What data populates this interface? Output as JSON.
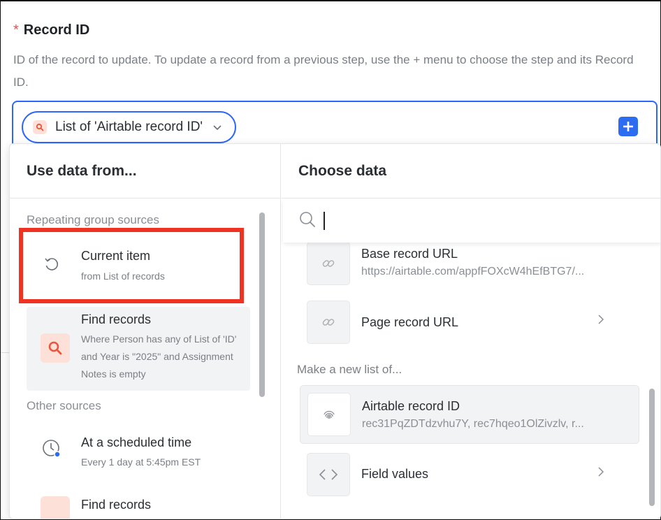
{
  "field": {
    "required_marker": "*",
    "label": "Record ID",
    "help": "ID of the record to update. To update a record from a previous step, use the + menu to choose the step and its Record ID."
  },
  "chip": {
    "label": "List of 'Airtable record ID'",
    "icon": "search-icon"
  },
  "plus_button": {
    "icon": "plus-icon"
  },
  "left_panel": {
    "header": "Use data from...",
    "sections": [
      {
        "title": "Repeating group sources",
        "items": [
          {
            "title": "Current item",
            "subtitle": "from List of records",
            "icon": "loop-icon"
          },
          {
            "title": "Find records",
            "subtitle": "Where Person has any of List of 'ID' and Year is \"2025\" and Assignment Notes is empty",
            "icon": "search-icon"
          }
        ]
      },
      {
        "title": "Other sources",
        "items": [
          {
            "title": "At a scheduled time",
            "subtitle": "Every 1 day at 5:45pm EST",
            "icon": "clock-icon"
          },
          {
            "title": "Find records",
            "subtitle": "",
            "icon": "search-icon"
          }
        ]
      }
    ]
  },
  "right_panel": {
    "header": "Choose data",
    "search": {
      "value": "",
      "icon": "search-icon"
    },
    "items": [
      {
        "title": "Base record URL",
        "subtitle": "https://airtable.com/appfFOXcW4hEfBTG7/...",
        "icon": "link-icon"
      },
      {
        "title": "Page record URL",
        "subtitle": "",
        "icon": "link-icon",
        "has_chevron": true
      }
    ],
    "list_section": {
      "title": "Make a new list of...",
      "items": [
        {
          "title": "Airtable record ID",
          "subtitle": "rec31PqZDTdzvhu7Y, rec7hqeo1OlZivzlv, r...",
          "icon": "fingerprint-icon",
          "selected": true
        },
        {
          "title": "Field values",
          "subtitle": "",
          "icon": "code-icon",
          "has_chevron": true
        }
      ]
    }
  },
  "colors": {
    "accent": "#2b67ff",
    "highlight": "#ee3322",
    "search_tile": "#fde0d8"
  }
}
